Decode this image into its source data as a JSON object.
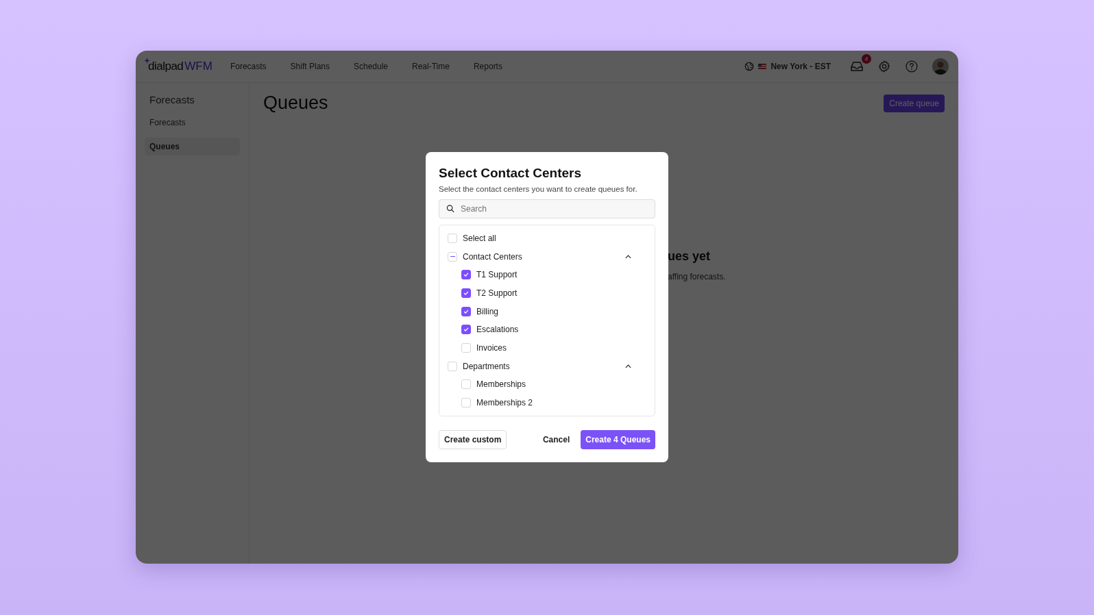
{
  "topbar": {
    "logo": {
      "brand": "dialpad",
      "product": "WFM"
    },
    "nav": [
      {
        "label": "Forecasts"
      },
      {
        "label": "Shift Plans"
      },
      {
        "label": "Schedule"
      },
      {
        "label": "Real-Time"
      },
      {
        "label": "Reports"
      }
    ],
    "timezone": "New York - EST",
    "inbox_badge": "4"
  },
  "sidebar": {
    "title": "Forecasts",
    "items": [
      {
        "label": "Forecasts",
        "selected": false
      },
      {
        "label": "Queues",
        "selected": true
      }
    ]
  },
  "page": {
    "title": "Queues",
    "button": "Create queue",
    "empty_title": "ues yet",
    "empty_text": "affing forecasts."
  },
  "modal": {
    "title": "Select Contact Centers",
    "subtitle": "Select the contact centers you want to create queues for.",
    "search": {
      "placeholder": "Search"
    },
    "select_all": {
      "label": "Select all",
      "checked": false
    },
    "groups": [
      {
        "label": "Contact Centers",
        "checked": false,
        "indeterminate": true,
        "expanded": true,
        "children": [
          {
            "label": "T1 Support",
            "checked": true
          },
          {
            "label": "T2 Support",
            "checked": true
          },
          {
            "label": "Billing",
            "checked": true
          },
          {
            "label": "Escalations",
            "checked": true
          },
          {
            "label": "Invoices",
            "checked": false
          }
        ]
      },
      {
        "label": "Departments",
        "checked": false,
        "indeterminate": false,
        "expanded": true,
        "children": [
          {
            "label": "Memberships",
            "checked": false
          },
          {
            "label": "Memberships 2",
            "checked": false
          }
        ]
      }
    ],
    "buttons": {
      "custom": "Create custom",
      "cancel": "Cancel",
      "create": "Create 4 Queues"
    }
  }
}
